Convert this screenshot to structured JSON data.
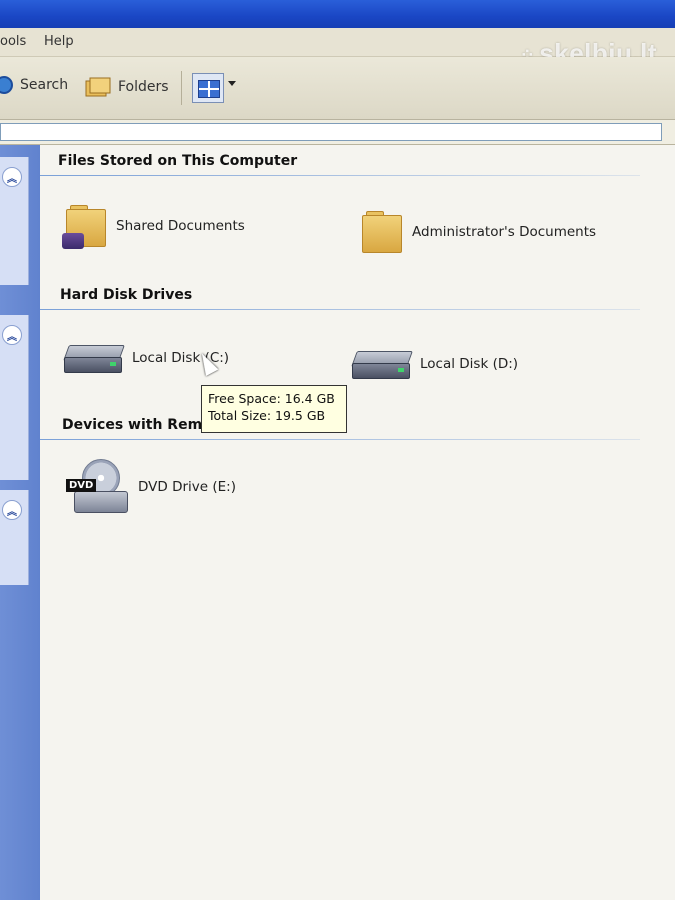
{
  "menu": {
    "tools": "ools",
    "help": "Help"
  },
  "watermark": {
    "text": "skelbiu.lt",
    "dots": "⁘"
  },
  "toolbar": {
    "search_label": "Search",
    "folders_label": "Folders"
  },
  "groups": {
    "files": {
      "title": "Files Stored on This Computer",
      "items": [
        {
          "label": "Shared Documents",
          "icon": "shared-folder-icon"
        },
        {
          "label": "Administrator's Documents",
          "icon": "folder-icon"
        }
      ]
    },
    "hdd": {
      "title": "Hard Disk Drives",
      "items": [
        {
          "label": "Local Disk (C:)",
          "icon": "hard-disk-icon"
        },
        {
          "label": "Local Disk (D:)",
          "icon": "hard-disk-icon"
        }
      ]
    },
    "removable": {
      "title": "Devices with Removable Storage",
      "items": [
        {
          "label": "DVD Drive (E:)",
          "icon": "dvd-drive-icon",
          "badge": "DVD"
        }
      ]
    }
  },
  "tooltip": {
    "free": "Free Space: 16.4 GB",
    "total": "Total Size: 19.5 GB"
  },
  "colors": {
    "titlebar": "#1a46c4",
    "pane": "#5a7dcb",
    "tooltip": "#ffffe1"
  }
}
